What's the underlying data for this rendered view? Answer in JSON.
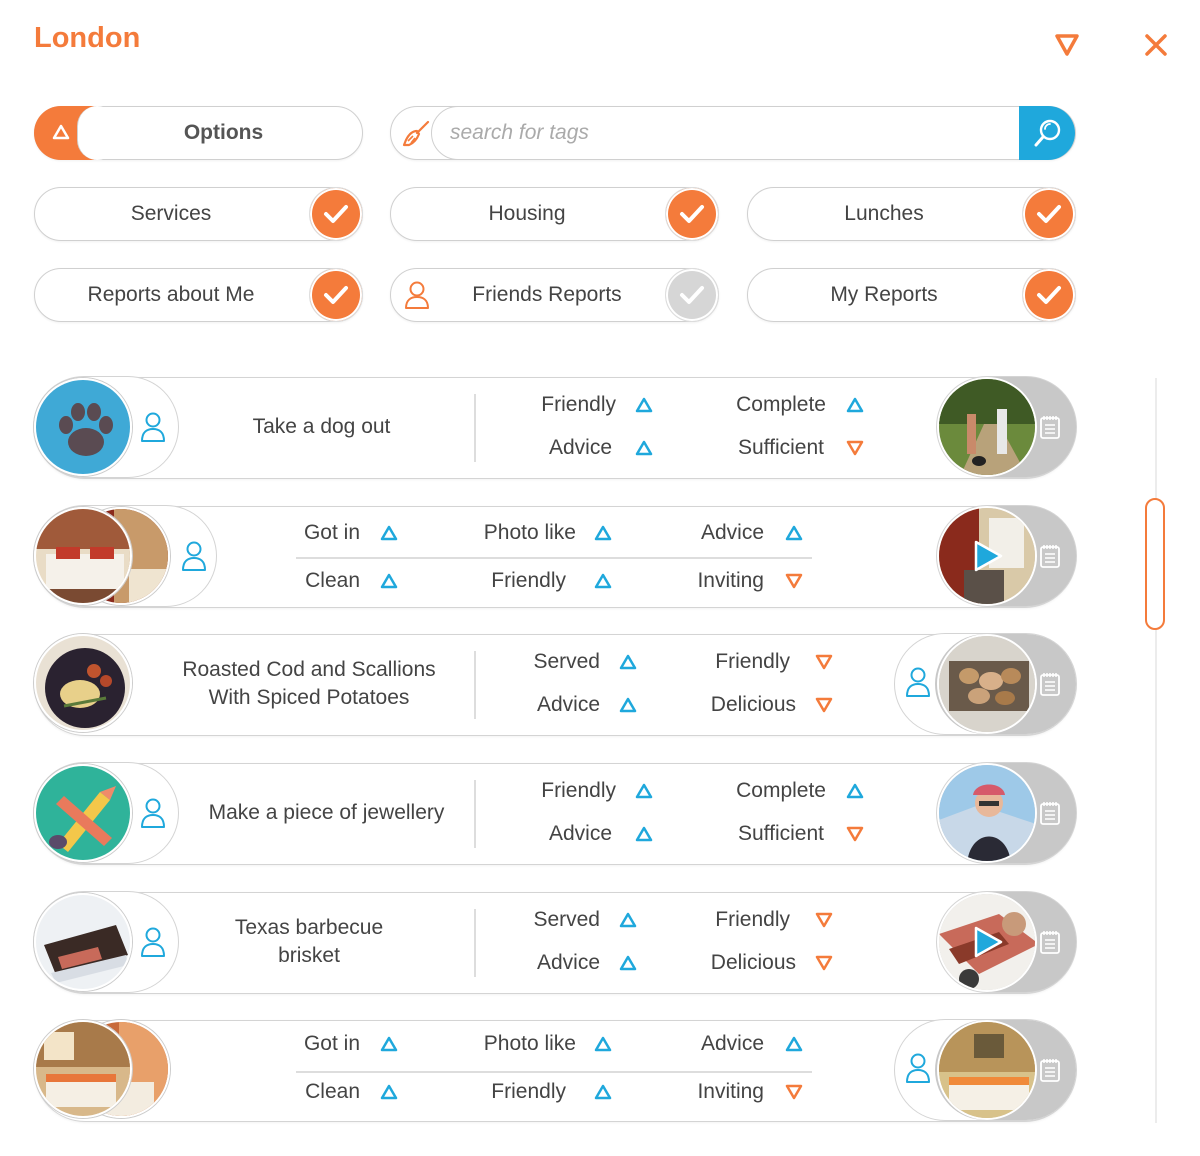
{
  "header": {
    "title": "London",
    "icons": [
      "triangle-down-icon",
      "close-icon"
    ]
  },
  "colors": {
    "accent": "#f47b3b",
    "blue": "#1fa8dc",
    "up_icon": "#1fa8dc",
    "down_icon": "#f47b3b",
    "inactive_check": "#d6d6d6"
  },
  "options": {
    "label": "Options"
  },
  "search": {
    "placeholder": "search for tags",
    "value": ""
  },
  "filters": [
    {
      "label": "Services",
      "checked": true
    },
    {
      "label": "Housing",
      "checked": true
    },
    {
      "label": "Lunches",
      "checked": true
    },
    {
      "label": "Reports about Me",
      "checked": true
    },
    {
      "label": "Friends Reports",
      "checked": false
    },
    {
      "label": "My Reports",
      "checked": true
    }
  ],
  "reports": [
    {
      "title": "Take a dog out",
      "tags": [
        {
          "label": "Friendly",
          "dir": "up"
        },
        {
          "label": "Complete",
          "dir": "up"
        },
        {
          "label": "Advice",
          "dir": "up"
        },
        {
          "label": "Sufficient",
          "dir": "down"
        }
      ]
    },
    {
      "title": "",
      "tags": [
        {
          "label": "Got in",
          "dir": "up"
        },
        {
          "label": "Photo like",
          "dir": "up"
        },
        {
          "label": "Advice",
          "dir": "up"
        },
        {
          "label": "Clean",
          "dir": "up"
        },
        {
          "label": "Friendly",
          "dir": "up"
        },
        {
          "label": "Inviting",
          "dir": "down"
        }
      ]
    },
    {
      "title_line1": "Roasted Cod and Scallions",
      "title_line2": "With Spiced Potatoes",
      "tags": [
        {
          "label": "Served",
          "dir": "up"
        },
        {
          "label": "Friendly",
          "dir": "down"
        },
        {
          "label": "Advice",
          "dir": "up"
        },
        {
          "label": "Delicious",
          "dir": "down"
        }
      ]
    },
    {
      "title": "Make a piece of jewellery",
      "tags": [
        {
          "label": "Friendly",
          "dir": "up"
        },
        {
          "label": "Complete",
          "dir": "up"
        },
        {
          "label": "Advice",
          "dir": "up"
        },
        {
          "label": "Sufficient",
          "dir": "down"
        }
      ]
    },
    {
      "title_line1": "Texas barbecue",
      "title_line2": "brisket",
      "tags": [
        {
          "label": "Served",
          "dir": "up"
        },
        {
          "label": "Friendly",
          "dir": "down"
        },
        {
          "label": "Advice",
          "dir": "up"
        },
        {
          "label": "Delicious",
          "dir": "down"
        }
      ]
    },
    {
      "title": "",
      "tags": [
        {
          "label": "Got in",
          "dir": "up"
        },
        {
          "label": "Photo like",
          "dir": "up"
        },
        {
          "label": "Advice",
          "dir": "up"
        },
        {
          "label": "Clean",
          "dir": "up"
        },
        {
          "label": "Friendly",
          "dir": "up"
        },
        {
          "label": "Inviting",
          "dir": "down"
        }
      ]
    }
  ]
}
